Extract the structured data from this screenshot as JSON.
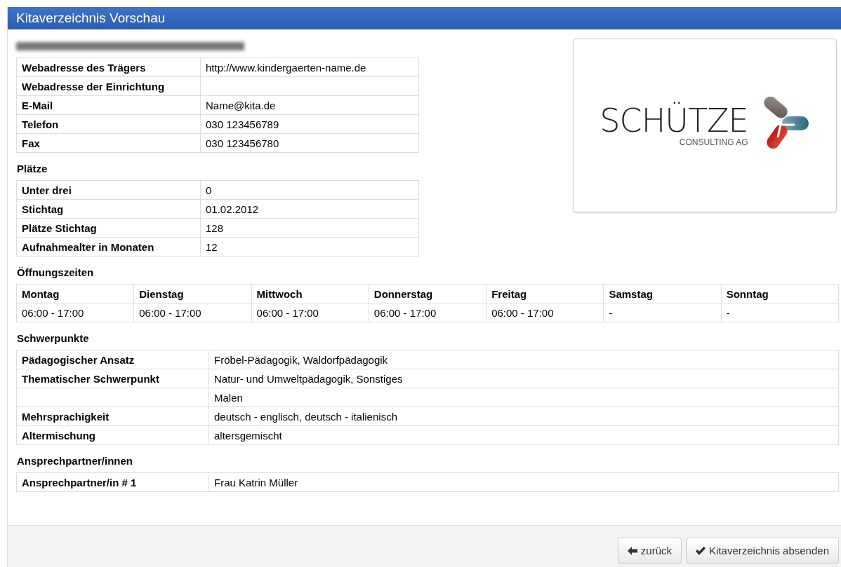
{
  "window": {
    "title": "Kitaverzeichnis Vorschau"
  },
  "contact_table": {
    "rows": [
      {
        "label": "Webadresse des Trägers",
        "value": "http://www.kindergaerten-name.de"
      },
      {
        "label": "Webadresse der Einrichtung"
      },
      {
        "label": "E-Mail",
        "value": "Name@kita.de"
      },
      {
        "label": "Telefon",
        "value": "030 123456789"
      },
      {
        "label": "Fax",
        "value": "030 123456780"
      }
    ]
  },
  "logo": {
    "name": "SCHÜTZE",
    "subtitle": "CONSULTING AG"
  },
  "places": {
    "heading": "Plätze",
    "rows": [
      {
        "label": "Unter drei",
        "value": "0"
      },
      {
        "label": "Stichtag",
        "value": "01.02.2012"
      },
      {
        "label": "Plätze Stichtag",
        "value": "128"
      },
      {
        "label": "Aufnahmealter in Monaten",
        "value": "12"
      }
    ]
  },
  "opening_hours": {
    "heading": "Öffnungszeiten",
    "columns": [
      "Montag",
      "Dienstag",
      "Mittwoch",
      "Donnerstag",
      "Freitag",
      "Samstag",
      "Sonntag"
    ],
    "values": [
      "06:00 - 17:00",
      "06:00 - 17:00",
      "06:00 - 17:00",
      "06:00 - 17:00",
      "06:00 - 17:00",
      "-",
      "-"
    ]
  },
  "focus": {
    "heading": "Schwerpunkte",
    "rows": [
      {
        "label": "Pädagogischer Ansatz",
        "value": "Fröbel-Pädagogik, Waldorfpädagogik"
      },
      {
        "label": "Thematischer Schwerpunkt",
        "value": "Natur- und Umweltpädagogik, Sonstiges"
      },
      {
        "value": "Malen"
      },
      {
        "label": "Mehrsprachigkeit",
        "value": "deutsch - englisch, deutsch - italienisch"
      },
      {
        "label": "Altermischung",
        "value": "altersgemischt"
      }
    ]
  },
  "contacts": {
    "heading": "Ansprechpartner/innen",
    "rows": [
      {
        "label": "Ansprechpartner/in # 1",
        "value": "Frau Katrin Müller"
      }
    ]
  },
  "buttons": [
    {
      "kind": "back",
      "label": "zurück"
    },
    {
      "kind": "submit",
      "label": "Kitaverzeichnis absenden"
    }
  ]
}
